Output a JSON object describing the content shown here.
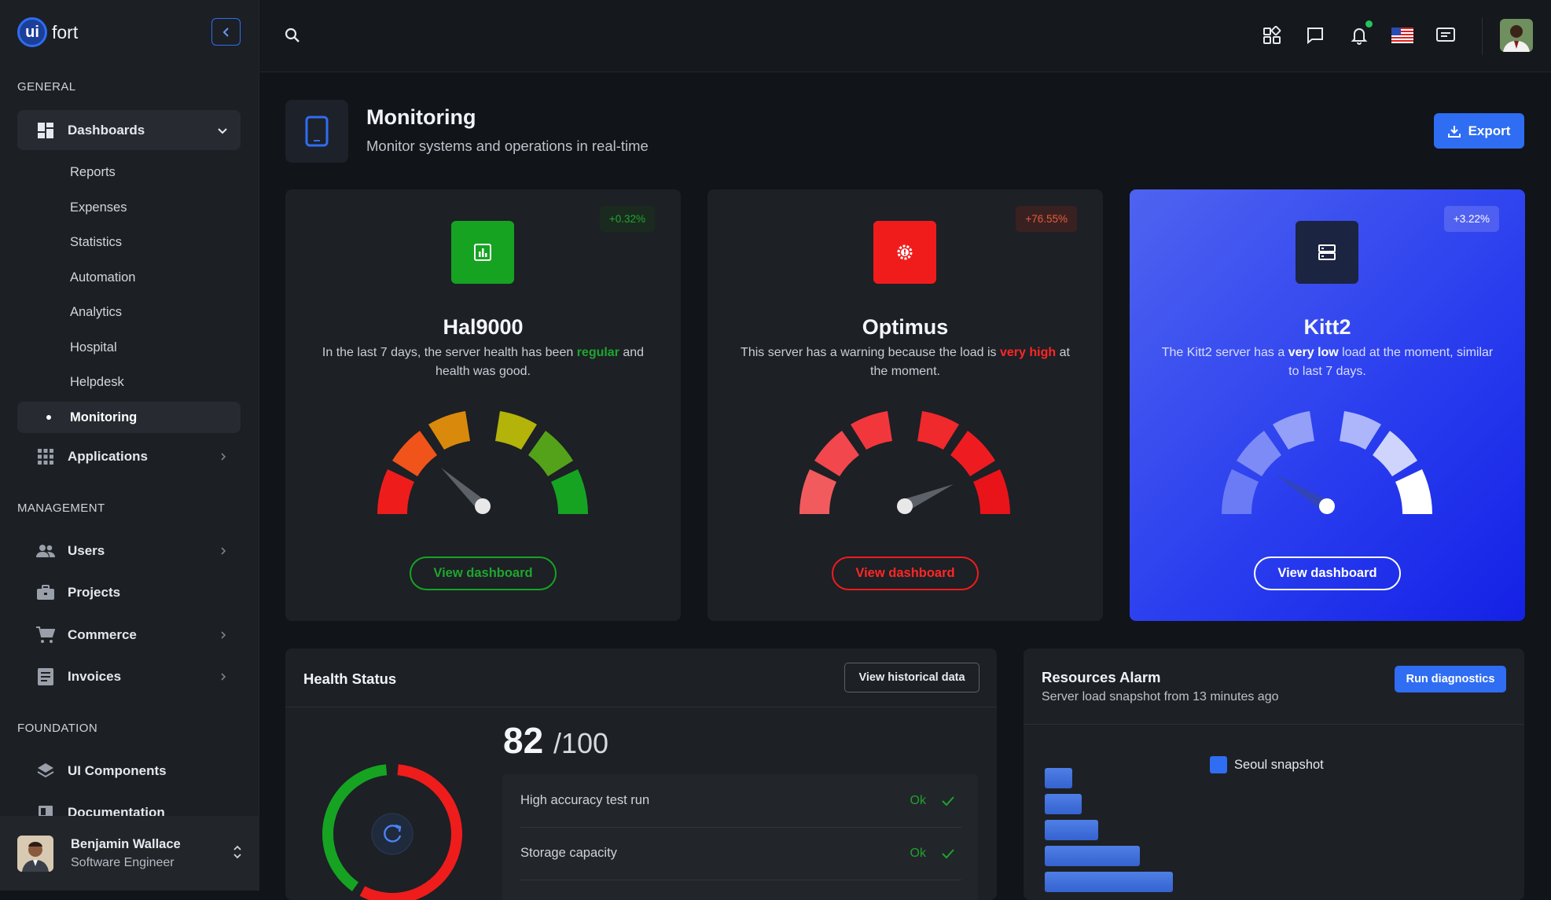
{
  "brand": {
    "logo_text": "ui",
    "name": "fort"
  },
  "sidebar": {
    "sections": {
      "general": "GENERAL",
      "management": "MANAGEMENT",
      "foundation": "FOUNDATION"
    },
    "dashboards": {
      "label": "Dashboards",
      "icon": "dashboard-icon",
      "expanded": true
    },
    "sub_items": [
      "Reports",
      "Expenses",
      "Statistics",
      "Automation",
      "Analytics",
      "Hospital",
      "Helpdesk",
      "Monitoring"
    ],
    "active_sub_item": "Monitoring",
    "applications": {
      "label": "Applications",
      "icon": "apps-grid-icon"
    },
    "management_items": [
      {
        "label": "Users",
        "icon": "users-icon"
      },
      {
        "label": "Projects",
        "icon": "briefcase-icon"
      },
      {
        "label": "Commerce",
        "icon": "cart-icon"
      },
      {
        "label": "Invoices",
        "icon": "invoice-icon"
      }
    ],
    "foundation_items": [
      {
        "label": "UI Components",
        "icon": "layers-icon"
      },
      {
        "label": "Documentation",
        "icon": "book-icon"
      }
    ],
    "user": {
      "name": "Benjamin Wallace",
      "role": "Software Engineer"
    }
  },
  "topbar": {
    "icons": [
      "search-icon",
      "widgets-icon",
      "chat-icon",
      "bell-icon",
      "us-flag-icon",
      "screen-message-icon",
      "avatar"
    ],
    "notification_dot_color": "#22c55e"
  },
  "page": {
    "title": "Monitoring",
    "subtitle": "Monitor systems and operations in real-time",
    "export_label": "Export"
  },
  "cards": [
    {
      "name": "Hal9000",
      "badge": "+0.32%",
      "desc_pre": "In the last 7 days, the server health has been ",
      "desc_highlight": "regular",
      "desc_post": " and health was good.",
      "button": "View dashboard",
      "accent": "#16a34a",
      "gauge_level": 0.3
    },
    {
      "name": "Optimus",
      "badge": "+76.55%",
      "desc_pre": "This server has a warning because the load is ",
      "desc_highlight": "very high",
      "desc_post": " at the moment.",
      "button": "View dashboard",
      "accent": "#ef1c1c",
      "gauge_level": 0.85
    },
    {
      "name": "Kitt2",
      "badge": "+3.22%",
      "desc_pre": "The Kitt2 server has a ",
      "desc_highlight": "very low",
      "desc_post": " load at the moment, similar to last 7 days.",
      "button": "View dashboard",
      "accent": "#ffffff",
      "gauge_level": 0.25
    }
  ],
  "health": {
    "title": "Health Status",
    "history_button": "View historical data",
    "score": "82",
    "score_max": "/100",
    "checks": [
      {
        "label": "High accuracy test run",
        "status": "Ok"
      },
      {
        "label": "Storage capacity",
        "status": "Ok"
      }
    ]
  },
  "resources": {
    "title": "Resources Alarm",
    "subtitle": "Server load snapshot from 13 minutes ago",
    "button": "Run diagnostics",
    "legend": "Seoul snapshot",
    "legend_color": "#2f6df2"
  }
}
